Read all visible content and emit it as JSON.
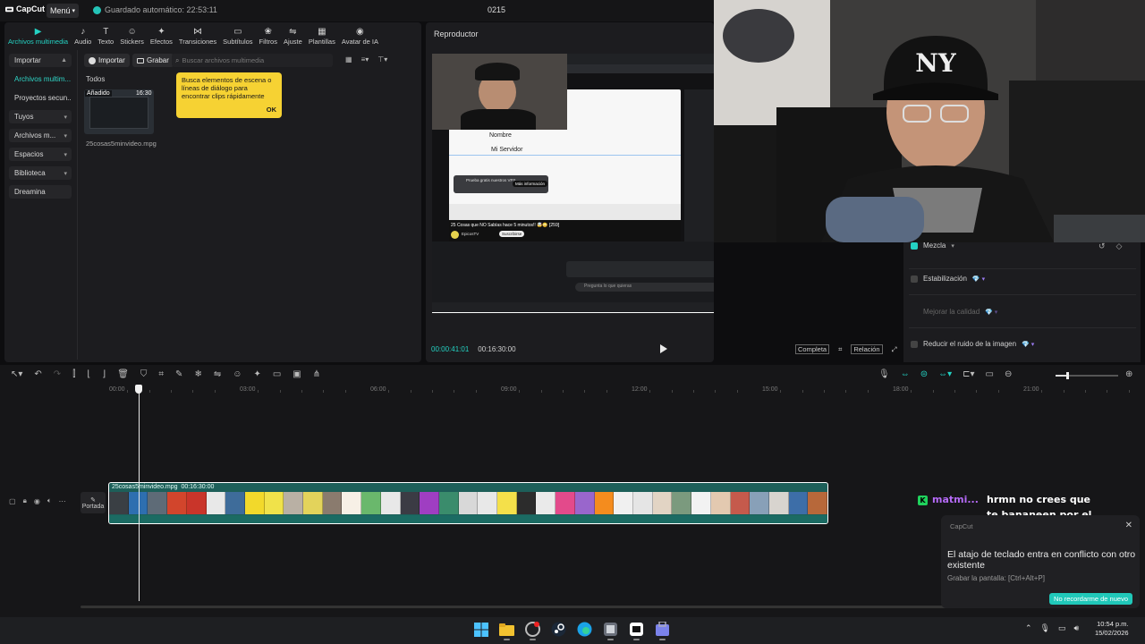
{
  "topbar": {
    "app_name": "CapCut",
    "menu_label": "Menú",
    "autosave": "Guardado automático: 22:53:11",
    "project_title": "0215"
  },
  "media": {
    "tools": [
      {
        "label": "Archivos multimedia",
        "icon": "media-icon",
        "active": true
      },
      {
        "label": "Audio",
        "icon": "audio-icon"
      },
      {
        "label": "Texto",
        "icon": "text-icon"
      },
      {
        "label": "Stickers",
        "icon": "sticker-icon"
      },
      {
        "label": "Efectos",
        "icon": "effects-icon"
      },
      {
        "label": "Transiciones",
        "icon": "transitions-icon"
      },
      {
        "label": "Subtítulos",
        "icon": "subtitles-icon"
      },
      {
        "label": "Filtros",
        "icon": "filters-icon"
      },
      {
        "label": "Ajuste",
        "icon": "adjust-icon"
      },
      {
        "label": "Plantillas",
        "icon": "templates-icon"
      },
      {
        "label": "Avatar de IA",
        "icon": "ai-avatar-icon"
      }
    ],
    "sidenav": [
      {
        "label": "Importar",
        "chev": "▲",
        "style": "box"
      },
      {
        "label": "Archivos multim...",
        "chev": "",
        "style": "active"
      },
      {
        "label": "Proyectos secun...",
        "chev": "",
        "style": "plain"
      },
      {
        "label": "Tuyos",
        "chev": "▾",
        "style": "box"
      },
      {
        "label": "Archivos m...",
        "chev": "▾",
        "style": "box"
      },
      {
        "label": "Espacios",
        "chev": "▾",
        "style": "box"
      },
      {
        "label": "Biblioteca",
        "chev": "▾",
        "style": "box"
      },
      {
        "label": "Dreamina",
        "chev": "",
        "style": "box"
      }
    ],
    "import_label": "Importar",
    "record_label": "Grabar",
    "search_placeholder": "Buscar archivos multimedia",
    "section_label": "Todos",
    "item": {
      "badge": "Añadido",
      "duration": "16:30",
      "filename": "25cosas5minvideo.mpg"
    },
    "tooltip": {
      "text": "Busca elementos de escena o líneas de diálogo para encontrar clips rápidamente",
      "ok": "OK"
    }
  },
  "player": {
    "title": "Reproductor",
    "current_time": "00:00:41:01",
    "total_time": "00:16:30:00",
    "complete_label": "Completa",
    "ratio_label": "Relación",
    "screen": {
      "name_label": "Nombre",
      "server_value": "Mi Servidor",
      "video_title": "25 Cosas que NO Sabías hace 5 minutos!! 🤯😳 [259]",
      "channel": "EpicosTV",
      "subscribe": "Suscribirse",
      "prompt": "Pregunta lo que quieras",
      "more_info": "Más información",
      "promo": "Prueba gratis nuestros VPS"
    }
  },
  "properties": {
    "rows": [
      {
        "label": "Mezcla",
        "checked": true,
        "suffix": "▾"
      },
      {
        "label": "Estabilización",
        "checked": false,
        "suffix": "💎 ▾"
      },
      {
        "label": "Mejorar la calidad",
        "checked": null,
        "suffix": "💎 ▾"
      },
      {
        "label": "Reducir el ruido de la imagen",
        "checked": false,
        "suffix": "💎 ▾"
      }
    ]
  },
  "timeline": {
    "ruler": [
      "00:00",
      "03:00",
      "06:00",
      "09:00",
      "12:00",
      "15:00",
      "18:00",
      "21:00"
    ],
    "cover_label": "Portada",
    "clip_name": "25cosas5minvideo.mpg",
    "clip_duration": "00:16:30:00",
    "frame_colors": [
      "#3a3f44",
      "#2e6fb0",
      "#5e6b77",
      "#d2452c",
      "#c9352a",
      "#e8e8e8",
      "#3e6c9a",
      "#f2d92b",
      "#f0e24a",
      "#b9b0a4",
      "#e3d35b",
      "#8a7b6e",
      "#f7f0e6",
      "#6ab86c",
      "#e8e8e8",
      "#3b3b44",
      "#9f3ec2",
      "#3a8c6c",
      "#d8d8d8",
      "#e8e8e8",
      "#f4e04a",
      "#2c2c2c",
      "#eaeaea",
      "#e34a8b",
      "#9966cc",
      "#f48c1e",
      "#f0f0f0",
      "#e5e5e5",
      "#e2d4c4",
      "#7b9a7e",
      "#f2f2f2",
      "#e3c9b0",
      "#c55a4c",
      "#88a0b8",
      "#d8d4cf",
      "#3d6ea8",
      "#b7683a"
    ]
  },
  "chat": {
    "user": "matmi...",
    "message": "hrmn no crees que te bananeen por el polnito lico",
    "badge": "K"
  },
  "notification": {
    "brand": "CapCut",
    "title": "El atajo de teclado entra en conflicto con otro existente",
    "subtitle": "Grabar la pantalla: [Ctrl+Alt+P]",
    "button": "No recordarme de nuevo"
  },
  "taskbar": {
    "time": "10:54 p.m.",
    "date": "15/02/2026",
    "apps": [
      "windows-start-icon",
      "file-explorer-icon",
      "browser-record-icon",
      "steam-icon",
      "edge-icon",
      "app-icon",
      "capcut-icon",
      "store-icon"
    ]
  },
  "colors": {
    "accent": "#24d2c3",
    "tooltip_bg": "#f6d233",
    "clip_bg": "#1d5f59",
    "chat_user": "#b56af7"
  }
}
